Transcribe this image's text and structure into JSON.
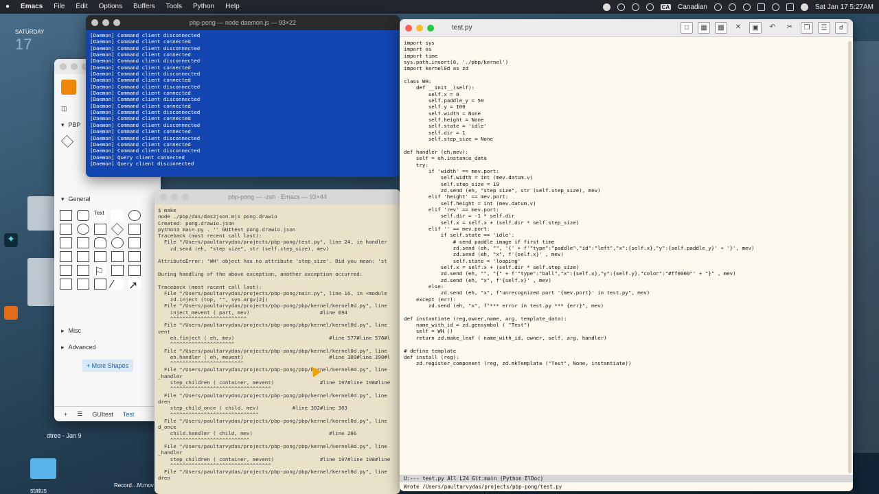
{
  "menubar": {
    "apple": "",
    "app": "Emacs",
    "items": [
      "File",
      "Edit",
      "Options",
      "Buffers",
      "Tools",
      "Python",
      "Help"
    ],
    "input_source": "Canadian",
    "clock": "Sat Jan 17  5:27AM",
    "ca": "CA"
  },
  "desktop": {
    "day": "SATURDAY",
    "date": "17",
    "dtree_label": "dtree - Jan 9",
    "status_label": "status",
    "record_label": "Record…M.mov"
  },
  "drawio": {
    "pbp": "PBP",
    "general": "General",
    "misc": "Misc",
    "advanced": "Advanced",
    "more_shapes": "+ More Shapes",
    "tabs": [
      "GUItest",
      "Test"
    ]
  },
  "daemon": {
    "title": "pbp-pong — node daemon.js — 93×22",
    "lines": [
      "[Daemon] Command client disconnected",
      "[Daemon] Command client connected",
      "[Daemon] Command client disconnected",
      "[Daemon] Command client connected",
      "[Daemon] Command client disconnected",
      "[Daemon] Command client connected",
      "[Daemon] Command client disconnected",
      "[Daemon] Command client connected",
      "[Daemon] Command client disconnected",
      "[Daemon] Command client connected",
      "[Daemon] Command client disconnected",
      "[Daemon] Command client connected",
      "[Daemon] Command client disconnected",
      "[Daemon] Command client connected",
      "[Daemon] Command client disconnected",
      "[Daemon] Command client connected",
      "[Daemon] Command client disconnected",
      "[Daemon] Command client connected",
      "[Daemon] Command client disconnected",
      "[Daemon] Query client connected",
      "[Daemon] Query client disconnected"
    ]
  },
  "zsh": {
    "title": "pbp-pong — -zsh · Emacs — 93×44",
    "text": "$ make\nnode ./pbp/das/das2json.mjs pong.drawio\nCreated: pong.drawio.json\npython3 main.py . '' GUItest pong.drawio.json\nTraceback (most recent call last):\n  File \"/Users/paultarvydas/projects/pbp-pong/test.py\", line 24, in handler\n    zd.send (eh, \"step size\", str (self.step_size), mev)\n\nAttributeError: 'WH' object has no attribute 'step_size'. Did you mean: 'st\n\nDuring handling of the above exception, another exception occurred:\n\nTraceback (most recent call last):\n  File \"/Users/paultarvydas/projects/pbp-pong/main.py\", line 16, in <module\n    zd.inject (top, \"\", sys.argv[2])\n  File \"/Users/paultarvydas/projects/pbp-pong/pbp/kernel/kernel0d.py\", line\n    inject_mevent ( part, mev)                       #line 694\n    ^^^^^^^^^^^^^^^^^^^^^^^^^\n  File \"/Users/paultarvydas/projects/pbp-pong/pbp/kernel/kernel0d.py\", line\nvent\n    eh.finject ( eh, mev)                               #line 577#line 578#l\n    ^^^^^^^^^^^^^^^^^^^^^\n  File \"/Users/paultarvydas/projects/pbp-pong/pbp/kernel/kernel0d.py\", line\n    eh.handler ( eh, mevent)                            #line 389#line 390#l\n    ^^^^^^^^^^^^^^^^^^^^^^^^\n  File \"/Users/paultarvydas/projects/pbp-pong/pbp/kernel/kernel0d.py\", line\n_handler\n    step_children ( container, mevent)               #line 197#line 198#line\n    ^^^^^^^^^^^^^^^^^^^^^^^^^^^^^^^^^\n  File \"/Users/paultarvydas/projects/pbp-pong/pbp/kernel/kernel0d.py\", line\ndren\n    step_child_once ( child, mev)           #line 302#line 303\n    ^^^^^^^^^^^^^^^^^^^^^^^^^^^^^\n  File \"/Users/paultarvydas/projects/pbp-pong/pbp/kernel/kernel0d.py\", line\nd_once\n    child.handler ( child, mev)                         #line 286\n    ^^^^^^^^^^^^^^^^^^^^^^^^^^\n  File \"/Users/paultarvydas/projects/pbp-pong/pbp/kernel/kernel0d.py\", line\n_handler\n    step_children ( container, mevent)               #line 197#line 198#line\n    ^^^^^^^^^^^^^^^^^^^^^^^^^^^^^^^^^\n  File \"/Users/paultarvydas/projects/pbp-pong/pbp/kernel/kernel0d.py\", line\ndren"
  },
  "emacs": {
    "title": "test.py",
    "tools": [
      "new-file",
      "open-folder",
      "save",
      "close",
      "save-as",
      "undo",
      "cut",
      "copy",
      "paste",
      "search"
    ],
    "modeline": "U:---  test.py         All   L24   Git:main   (Python ElDoc)",
    "echo": "Wrote /Users/paultarvydas/projects/pbp-pong/test.py",
    "code": "import sys\nimport os\nimport time\nsys.path.insert(0, './pbp/kernel')\nimport kernel0d as zd\n\nclass WH:\n    def __init__(self):\n        self.x = 0\n        self.paddle_y = 50\n        self.y = 100\n        self.width = None\n        self.height = None\n        self.state = 'idle'\n        self.dir = 1\n        self.step_size = None\n\ndef handler (eh,mev):\n    self = eh.instance_data\n    try:\n        if 'width' == mev.port:\n            self.width = int (mev.datum.v)\n            self.step_size = 19\n            zd.send (eh, \"step size\", str (self.step_size), mev)\n        elif 'height' == mev.port:\n            self.height = int (mev.datum.v)\n        elif 'rev' == mev.port:\n            self.dir = -1 * self.dir\n            self.x = self.x + (self.dir * self.step_size)\n        elif '' == mev.port:\n            if self.state == 'idle':\n                # send paddle image if first time\n                zd.send (eh, \"\", '{' + f'\"type\":\"paddle\",\"id\":\"left\",\"x\":{self.x},\"y\":{self.paddle_y}' + '}', mev)\n                zd.send (eh, \"x\", f'{self.x}' , mev)\n                self.state = 'looping'\n            self.x = self.x + (self.dir * self.step_size)\n            zd.send (eh, \"\", \"{\" + f'\"type\":\"ball\",\"x\":{self.x},\"y\":{self.y},\"color\":\"#ff0000\"' + \"}\" , mev)\n            zd.send (eh, \"x\", f'{self.x}' , mev)\n        else:\n            zd.send (eh, \"x\", f\"unrecognized port '{mev.port}' in test.py\", mev)\n    except (err):\n        zd.send (eh, \"x\", f\"*** error in test.py *** {err}\", mev)\n\ndef instantiate (reg,owner,name, arg, template_data):\n    name_with_id = zd.gensymbol ( \"Test\")\n    self = WH ()\n    return zd.make_leaf ( name_with_id, owner, self, arg, handler)\n\n# define template\ndef install (reg):\n    zd.register_component (reg, zd.mkTemplate (\"Test\", None, instantiate))"
  }
}
